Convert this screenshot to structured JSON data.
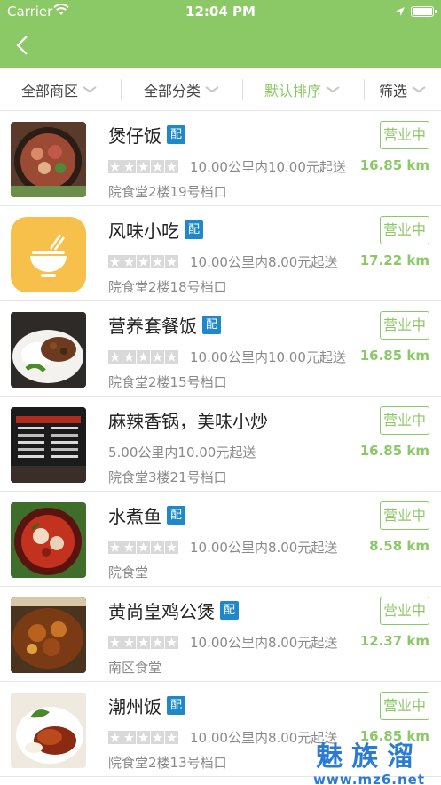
{
  "statusbar": {
    "carrier": "Carrier",
    "time": "12:04 PM"
  },
  "filters": [
    {
      "label": "全部商区",
      "active": false
    },
    {
      "label": "全部分类",
      "active": false
    },
    {
      "label": "默认排序",
      "active": true
    },
    {
      "label": "筛选",
      "active": false
    }
  ],
  "colors": {
    "brand_green": "#8bc866",
    "pei_blue": "#1e88c8",
    "watermark_blue": "#2a7bd4"
  },
  "rows": [
    {
      "name": "煲仔饭",
      "pei": "配",
      "has_stars": true,
      "delivery": "10.00公里内10.00元起送",
      "address": "院食堂2楼19号档口",
      "status": "营业中",
      "distance": "16.85 km",
      "thumb": "claypot-rice-photo"
    },
    {
      "name": "风味小吃",
      "pei": "配",
      "has_stars": true,
      "delivery": "10.00公里内8.00元起送",
      "address": "院食堂2楼18号档口",
      "status": "营业中",
      "distance": "17.22 km",
      "thumb": "noodle-bowl-icon"
    },
    {
      "name": "营养套餐饭",
      "pei": "配",
      "has_stars": true,
      "delivery": "10.00公里内10.00元起送",
      "address": "院食堂2楼15号档口",
      "status": "营业中",
      "distance": "16.85 km",
      "thumb": "rice-set-photo"
    },
    {
      "name": "麻辣香锅，美味小炒",
      "pei": "",
      "has_stars": false,
      "delivery": "5.00公里内10.00元起送",
      "address": "院食堂3楼21号档口",
      "status": "营业中",
      "distance": "16.85 km",
      "thumb": "menu-board-photo"
    },
    {
      "name": "水煮鱼",
      "pei": "配",
      "has_stars": true,
      "delivery": "10.00公里内8.00元起送",
      "address": "院食堂",
      "status": "营业中",
      "distance": "8.58 km",
      "thumb": "boiled-fish-photo"
    },
    {
      "name": "黄尚皇鸡公煲",
      "pei": "配",
      "has_stars": true,
      "delivery": "10.00公里内8.00元起送",
      "address": "南区食堂",
      "status": "营业中",
      "distance": "12.37 km",
      "thumb": "chicken-pot-photo"
    },
    {
      "name": "潮州饭",
      "pei": "配",
      "has_stars": true,
      "delivery": "10.00公里内8.00元起送",
      "address": "院食堂2楼13号档口",
      "status": "营业中",
      "distance": "16.85 km",
      "thumb": "roast-duck-photo"
    }
  ],
  "watermark": {
    "line1": "魅族溜",
    "line2": "www.mz6.net"
  }
}
